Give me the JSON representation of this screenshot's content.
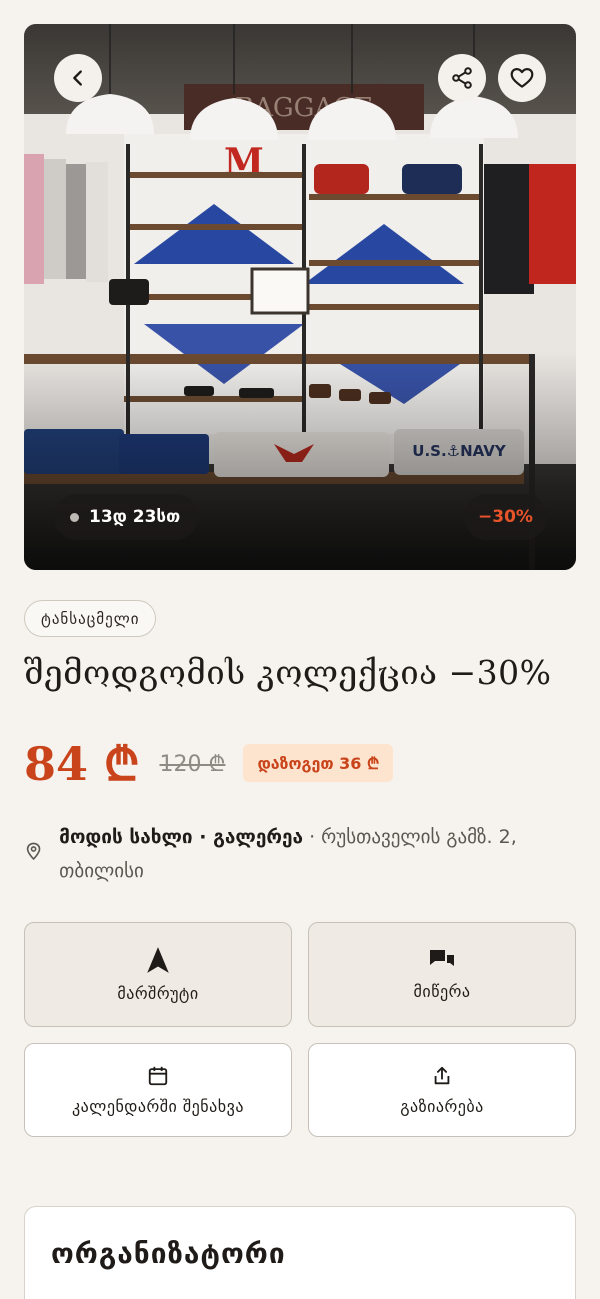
{
  "hero": {
    "timer": "13დ 23სთ",
    "discount": "−30%"
  },
  "category": "ტანსაცმელი",
  "title": "შემოდგომის კოლექცია −30%",
  "price": {
    "current": "84 ₾",
    "old": "120 ₾",
    "savings": "დაზოგეთ 36 ₾"
  },
  "location": {
    "venue": "მოდის სახლი · გალერეა",
    "address": " · რუსთაველის გამზ. 2, თბილისი"
  },
  "actions": {
    "route": "მარშრუტი",
    "message": "მიწერა",
    "calendar": "კალენდარში შენახვა",
    "share": "გაზიარება"
  },
  "organizer": {
    "title": "ორგანიზატორი"
  },
  "icons": [
    "back-icon",
    "share-icon",
    "heart-icon",
    "pin-icon",
    "navigation-icon",
    "chat-icon",
    "calendar-icon",
    "upload-icon"
  ],
  "colors": {
    "accent": "#c9441b",
    "discount": "#e8542a",
    "savings_bg": "#fde4cf",
    "background": "#f6f3ee"
  }
}
